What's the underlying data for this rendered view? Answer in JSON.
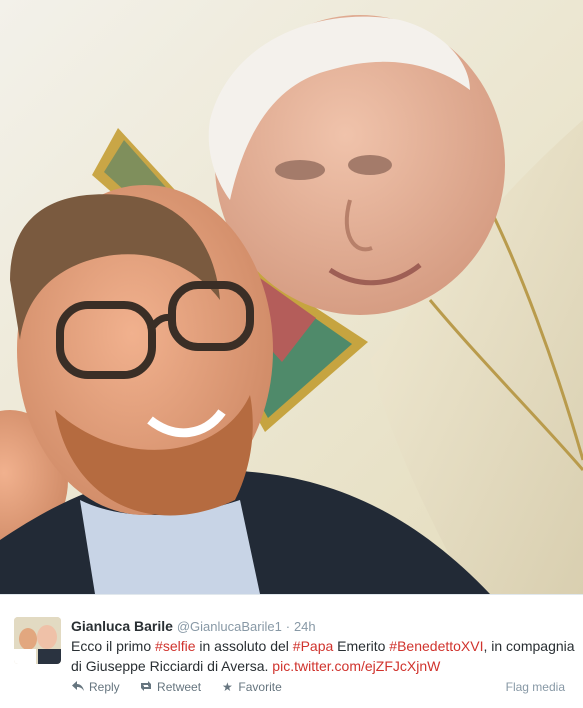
{
  "tweet": {
    "fullname": "Gianluca Barile",
    "username": "@GianlucaBarile1",
    "separator": "·",
    "time": "24h",
    "text": {
      "t1": "Ecco il primo ",
      "tag1": "#selfie",
      "t2": " in assoluto del ",
      "tag2": "#Papa",
      "t3": " Emerito ",
      "tag3": "#BenedettoXVI",
      "t4": ", in compagnia di Giuseppe Ricciardi di Aversa. ",
      "link": "pic.twitter.com/ejZFJcXjnW"
    },
    "actions": {
      "reply": "Reply",
      "retweet": "Retweet",
      "favorite": "Favorite"
    },
    "flag": "Flag media"
  },
  "icons": {
    "reply": "reply-icon",
    "retweet": "retweet-icon",
    "favorite": "star-icon"
  },
  "colors": {
    "hashtag_link": "#d0332d",
    "meta": "#8899a6"
  }
}
